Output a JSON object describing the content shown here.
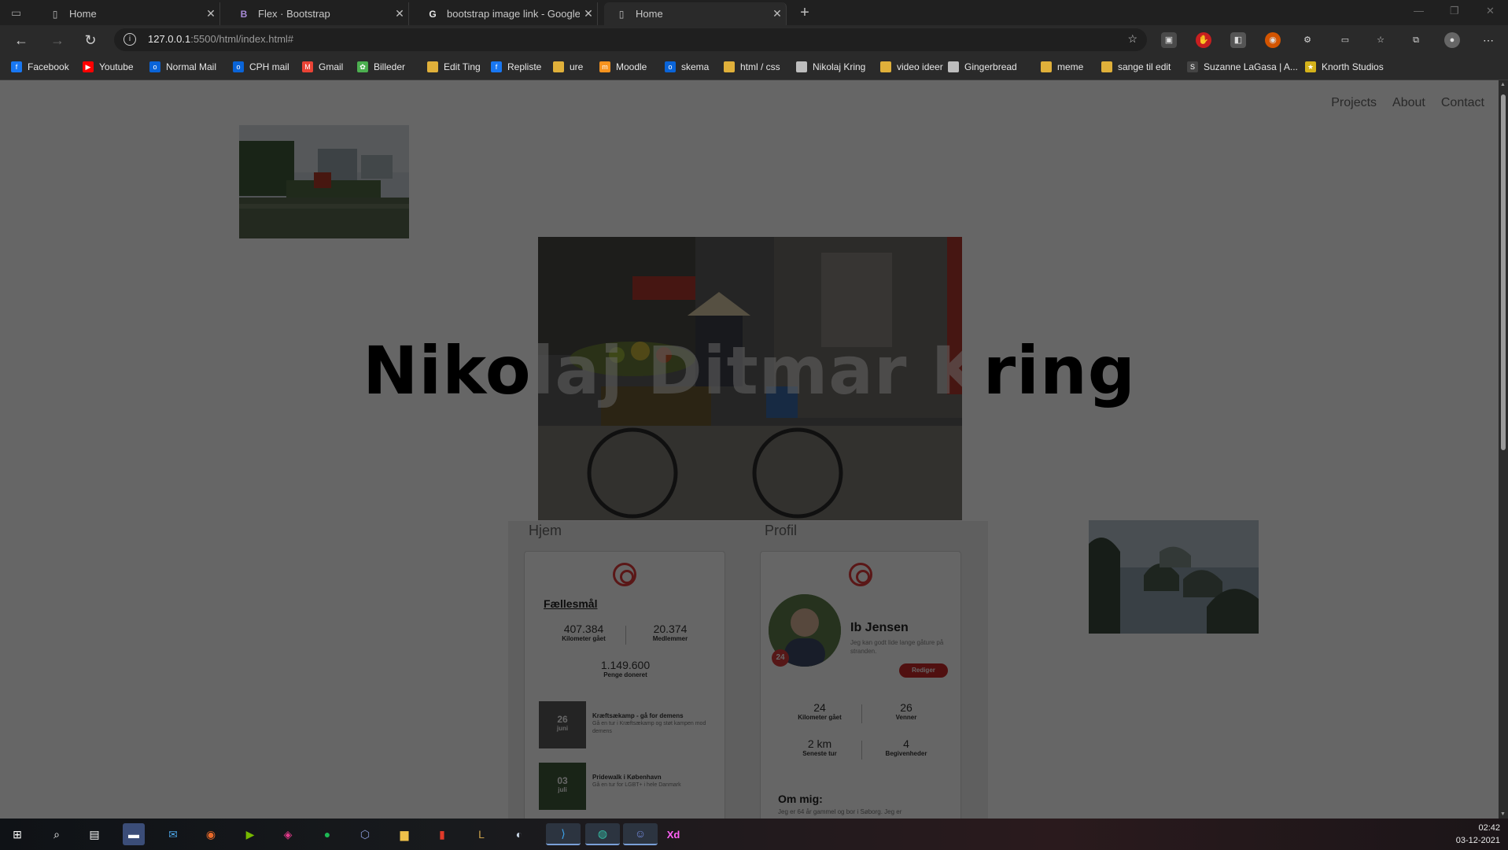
{
  "browser": {
    "tabs": [
      {
        "title": "Home",
        "icon": "page-icon",
        "active": false
      },
      {
        "title": "Flex · Bootstrap",
        "icon": "bootstrap-icon",
        "active": false
      },
      {
        "title": "bootstrap image link - Google-s",
        "icon": "google-icon",
        "active": false
      },
      {
        "title": "Home",
        "icon": "page-icon",
        "active": true
      }
    ],
    "address": {
      "host": "127.0.0.1",
      "rest": ":5500/html/index.html#"
    },
    "bookmarks": [
      {
        "label": "Facebook",
        "icon": "facebook-icon",
        "color": "#1877f2"
      },
      {
        "label": "Youtube",
        "icon": "youtube-icon",
        "color": "#ff0000"
      },
      {
        "label": "Normal Mail",
        "icon": "outlook-icon",
        "color": "#0a64d8"
      },
      {
        "label": "CPH mail",
        "icon": "outlook-icon",
        "color": "#0a64d8"
      },
      {
        "label": "Gmail",
        "icon": "gmail-icon",
        "color": "#ea4335"
      },
      {
        "label": "Billeder",
        "icon": "photos-icon",
        "color": "#4caf50"
      },
      {
        "label": "Edit Ting",
        "icon": "folder-icon",
        "color": "#e0b03a"
      },
      {
        "label": "Repliste",
        "icon": "facebook-icon",
        "color": "#1877f2"
      },
      {
        "label": "ure",
        "icon": "folder-icon",
        "color": "#e0b03a"
      },
      {
        "label": "Moodle",
        "icon": "moodle-icon",
        "color": "#f7931e"
      },
      {
        "label": "skema",
        "icon": "outlook-icon",
        "color": "#0a64d8"
      },
      {
        "label": "html / css",
        "icon": "folder-icon",
        "color": "#e0b03a"
      },
      {
        "label": "Nikolaj Kring",
        "icon": "page-icon",
        "color": "#bdbdbd"
      },
      {
        "label": "video ideer",
        "icon": "folder-icon",
        "color": "#e0b03a"
      },
      {
        "label": "Gingerbread",
        "icon": "page-icon",
        "color": "#bdbdbd"
      },
      {
        "label": "meme",
        "icon": "folder-icon",
        "color": "#e0b03a"
      },
      {
        "label": "sange til edit",
        "icon": "folder-icon",
        "color": "#e0b03a"
      },
      {
        "label": "Suzanne LaGasa | A...",
        "icon": "squarespace-icon",
        "color": "#444444"
      },
      {
        "label": "Knorth Studios",
        "icon": "knorth-icon",
        "color": "#d4b21a"
      }
    ]
  },
  "site": {
    "nav": [
      "Projects",
      "About",
      "Contact"
    ],
    "name_part1": "Niko",
    "name_part2": "laj Ditmar K",
    "name_part3": "ring",
    "mockup": {
      "home_label": "Hjem",
      "profile_label": "Profil",
      "goals_title": "Fællesmål",
      "stats": [
        {
          "num": "407.384",
          "lbl": "Kilometer gået"
        },
        {
          "num": "20.374",
          "lbl": "Medlemmer"
        },
        {
          "num": "1.149.600",
          "lbl": "Penge doneret"
        }
      ],
      "events": [
        {
          "day": "26",
          "month": "juni",
          "title": "Kræftsækamp - gå for demens",
          "desc": "Gå en tur i Kræftsækamp og støt kampen mod demens"
        },
        {
          "day": "03",
          "month": "juli",
          "title": "Pridewalk i København",
          "desc": "Gå en tur for LGBT+ i hele Danmark"
        }
      ],
      "profile": {
        "name": "Ib Jensen",
        "bio": "Jeg kan godt lide lange gåture på stranden.",
        "badge": "24",
        "edit": "Rediger",
        "stats": [
          {
            "num": "24",
            "lbl": "Kilometer gået"
          },
          {
            "num": "26",
            "lbl": "Venner"
          },
          {
            "num": "2 km",
            "lbl": "Seneste tur"
          },
          {
            "num": "4",
            "lbl": "Begivenheder"
          }
        ],
        "about_title": "Om mig:",
        "about_text": "Jeg er 64 år gammel og bor i Søborg. Jeg er"
      }
    }
  },
  "taskbar": {
    "time": "02:42",
    "date": "03-12-2021"
  }
}
